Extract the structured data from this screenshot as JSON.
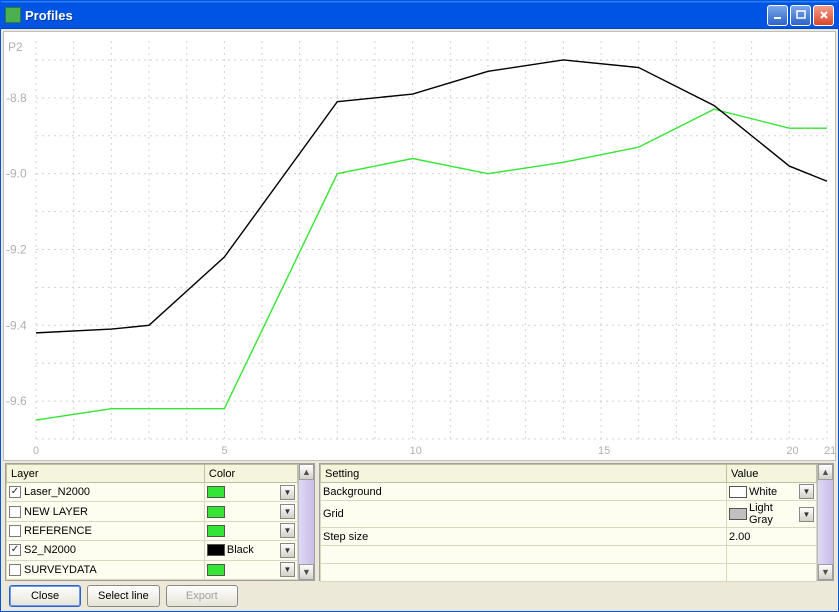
{
  "window": {
    "title": "Profiles"
  },
  "chart_data": {
    "type": "line",
    "xlabel": "",
    "ylabel": "",
    "xlim": [
      0,
      21
    ],
    "ylim": [
      -9.7,
      -8.65
    ],
    "x_ticks": [
      0,
      5,
      10,
      15,
      20,
      21
    ],
    "y_ticks": [
      -8.8,
      -9.0,
      -9.2,
      -9.4,
      -9.6
    ],
    "annotation": "P2",
    "series": [
      {
        "name": "S2_N2000",
        "color": "#000000",
        "x": [
          0,
          2,
          3,
          5,
          8,
          10,
          12,
          14,
          16,
          18,
          20,
          21
        ],
        "y": [
          -9.42,
          -9.41,
          -9.4,
          -9.22,
          -8.81,
          -8.79,
          -8.73,
          -8.7,
          -8.72,
          -8.82,
          -8.98,
          -9.02
        ]
      },
      {
        "name": "Laser_N2000",
        "color": "#33e633",
        "x": [
          0,
          2,
          3,
          5,
          8,
          10,
          12,
          14,
          16,
          18,
          20,
          21
        ],
        "y": [
          -9.65,
          -9.62,
          -9.62,
          -9.62,
          -9.0,
          -8.96,
          -9.0,
          -8.97,
          -8.93,
          -8.83,
          -8.88,
          -8.88
        ]
      }
    ]
  },
  "layer_panel": {
    "headers": {
      "layer": "Layer",
      "color": "Color"
    },
    "rows": [
      {
        "checked": true,
        "name": "Laser_N2000",
        "color": "#33e633",
        "color_name": ""
      },
      {
        "checked": false,
        "name": "NEW LAYER",
        "color": "#33e633",
        "color_name": ""
      },
      {
        "checked": false,
        "name": "REFERENCE",
        "color": "#33e633",
        "color_name": ""
      },
      {
        "checked": true,
        "name": "S2_N2000",
        "color": "#000000",
        "color_name": "Black"
      },
      {
        "checked": false,
        "name": "SURVEYDATA",
        "color": "#33e633",
        "color_name": ""
      }
    ]
  },
  "settings_panel": {
    "headers": {
      "setting": "Setting",
      "value": "Value"
    },
    "rows": [
      {
        "name": "Background",
        "type": "color-combo",
        "color": "#ffffff",
        "value": "White"
      },
      {
        "name": "Grid",
        "type": "color-combo",
        "color": "#c0c0c0",
        "value": "Light Gray"
      },
      {
        "name": "Step size",
        "type": "value",
        "value": "2.00"
      }
    ]
  },
  "buttons": {
    "close": "Close",
    "select_line": "Select line",
    "export": "Export"
  },
  "colors": {
    "grid": "#d0d0d0"
  }
}
